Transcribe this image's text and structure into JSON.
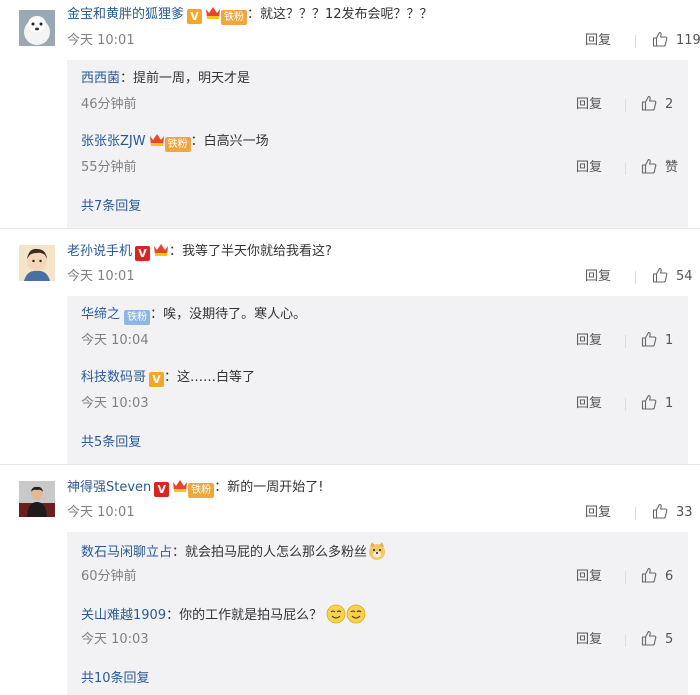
{
  "comments": [
    {
      "username": "金宝和黄胖的狐狸爹",
      "badge_tiefen": "铁粉",
      "content": "：就这？？？12发布会呢？？？",
      "time": "今天 10:01",
      "reply_label": "回复",
      "likes": "119",
      "replies": [
        {
          "username": "西西菌",
          "content": "：提前一周，明天才是",
          "time": "46分钟前",
          "reply_label": "回复",
          "likes": "2"
        },
        {
          "username": "张张张ZJW",
          "badge_tiefen": "铁粉",
          "content": "：白高兴一场",
          "time": "55分钟前",
          "reply_label": "回复",
          "likes": "赞"
        }
      ],
      "more": "共7条回复"
    },
    {
      "username": "老孙说手机",
      "content": "：我等了半天你就给我看这?",
      "time": "今天 10:01",
      "reply_label": "回复",
      "likes": "54",
      "replies": [
        {
          "username": "华缔之",
          "badge_tiefen": "铁粉",
          "content": "：唉，没期待了。寒人心。",
          "time": "今天 10:04",
          "reply_label": "回复",
          "likes": "1"
        },
        {
          "username": "科技数码哥",
          "content": "：这……白等了",
          "time": "今天 10:03",
          "reply_label": "回复",
          "likes": "1"
        }
      ],
      "more": "共5条回复"
    },
    {
      "username": "神得强Steven",
      "badge_tiefen": "铁粉",
      "content": "：新的一周开始了!",
      "time": "今天 10:01",
      "reply_label": "回复",
      "likes": "33",
      "replies": [
        {
          "username": "数石马闲聊立占",
          "content": "：就会拍马屁的人怎么那么多粉丝",
          "time": "60分钟前",
          "reply_label": "回复",
          "likes": "6"
        },
        {
          "username": "关山难越1909",
          "content": "：你的工作就是拍马屁么？",
          "time": "今天 10:03",
          "reply_label": "回复",
          "likes": "5"
        }
      ],
      "more": "共10条回复"
    }
  ],
  "badges": {
    "v": "V"
  },
  "colors": {
    "link": "#2a5a95",
    "reply_bg": "#f2f2f5",
    "v_orange": "#f5a623",
    "v_red": "#d6261d",
    "tiefen": "#f0a640"
  }
}
